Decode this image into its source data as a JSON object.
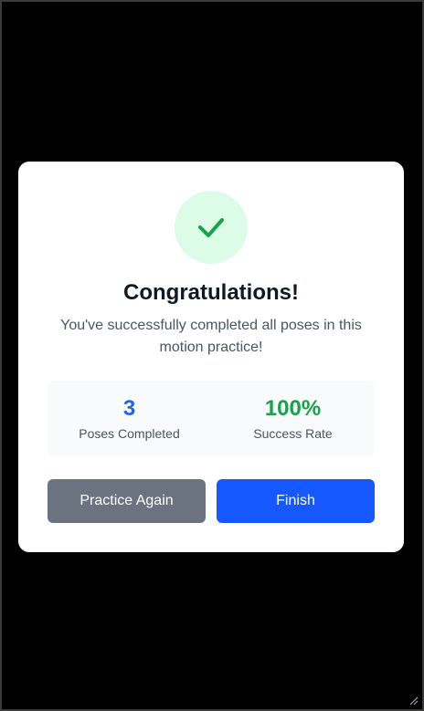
{
  "modal": {
    "title": "Congratulations!",
    "message": "You've successfully completed all poses in this motion practice!",
    "icon": "checkmark-icon",
    "stats": [
      {
        "value": "3",
        "label": "Poses Completed",
        "color": "#2563eb"
      },
      {
        "value": "100%",
        "label": "Success Rate",
        "color": "#16a34a"
      }
    ],
    "buttons": {
      "practice_again": "Practice Again",
      "finish": "Finish"
    }
  },
  "colors": {
    "backdrop": "#000000",
    "success_bg": "#dcfce7",
    "success": "#16a34a",
    "secondary_button": "#6b7280",
    "primary_button": "#1558ff"
  }
}
